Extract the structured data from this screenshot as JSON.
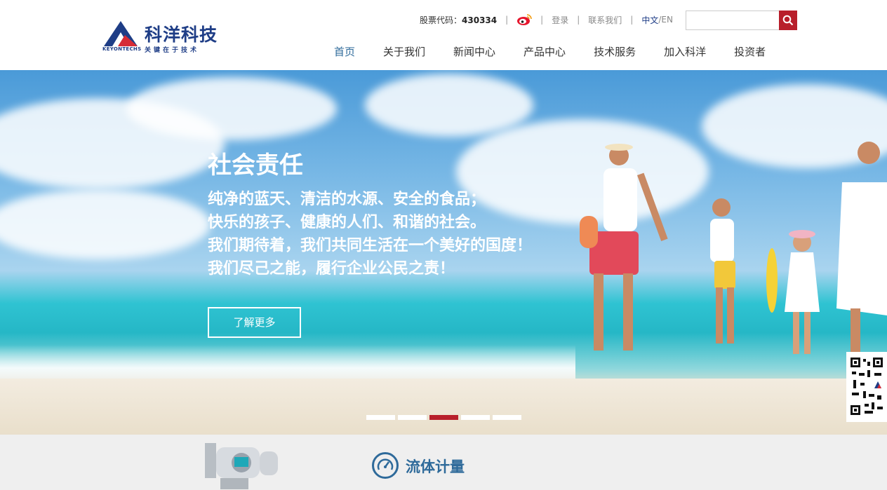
{
  "header": {
    "logo": {
      "name": "科洋科技",
      "en": "KEYONTECHS",
      "slogan": "关键在于技术"
    },
    "topbar": {
      "stock_label": "股票代码：",
      "stock_code": "430334",
      "login": "登录",
      "contact": "联系我们",
      "lang_cn": "中文",
      "lang_sep": "/",
      "lang_en": "EN"
    },
    "search": {
      "placeholder": ""
    },
    "nav": [
      "首页",
      "关于我们",
      "新闻中心",
      "产品中心",
      "技术服务",
      "加入科洋",
      "投资者"
    ]
  },
  "banner": {
    "title": "社会责任",
    "lines": [
      "纯净的蓝天、清洁的水源、安全的食品；",
      "快乐的孩子、健康的人们、和谐的社会。",
      "我们期待着，我们共同生活在一个美好的国度！",
      "我们尽己之能，履行企业公民之责！"
    ],
    "more_button": "了解更多",
    "slides_total": 5,
    "active_slide": 3
  },
  "section": {
    "title": "流体计量"
  },
  "colors": {
    "brand_blue": "#1e3d86",
    "accent_red": "#b81f2b",
    "nav_active": "#2e6a9a"
  }
}
